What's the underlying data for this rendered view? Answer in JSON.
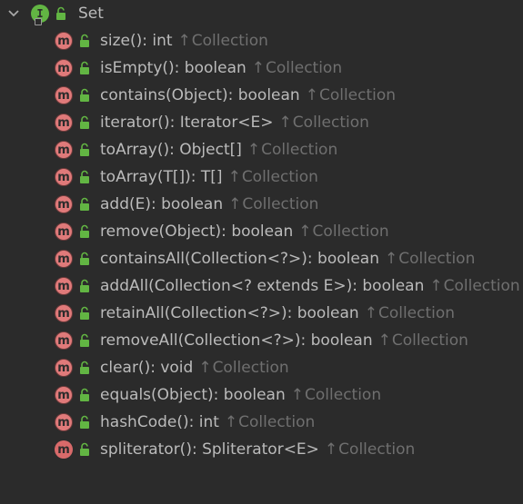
{
  "root": {
    "label": "Set",
    "icon": "interface-icon",
    "icon_letter": "I",
    "expanded": true
  },
  "colors": {
    "background": "#2b2b2b",
    "text": "#bbbbbb",
    "inherited_text": "#6f6f6f",
    "method_icon": "#e07a7a",
    "interface_icon": "#62b543",
    "lock_icon": "#62b543"
  },
  "method_icon_letter": "m",
  "arrow_glyph": "↑",
  "methods": [
    {
      "signature": "size(): int",
      "origin": "Collection"
    },
    {
      "signature": "isEmpty(): boolean",
      "origin": "Collection"
    },
    {
      "signature": "contains(Object): boolean",
      "origin": "Collection"
    },
    {
      "signature": "iterator(): Iterator<E>",
      "origin": "Collection"
    },
    {
      "signature": "toArray(): Object[]",
      "origin": "Collection"
    },
    {
      "signature": "toArray(T[]): T[]",
      "origin": "Collection"
    },
    {
      "signature": "add(E): boolean",
      "origin": "Collection"
    },
    {
      "signature": "remove(Object): boolean",
      "origin": "Collection"
    },
    {
      "signature": "containsAll(Collection<?>): boolean",
      "origin": "Collection"
    },
    {
      "signature": "addAll(Collection<? extends E>): boolean",
      "origin": "Collection"
    },
    {
      "signature": "retainAll(Collection<?>): boolean",
      "origin": "Collection"
    },
    {
      "signature": "removeAll(Collection<?>): boolean",
      "origin": "Collection"
    },
    {
      "signature": "clear(): void",
      "origin": "Collection"
    },
    {
      "signature": "equals(Object): boolean",
      "origin": "Collection"
    },
    {
      "signature": "hashCode(): int",
      "origin": "Collection"
    },
    {
      "signature": "spliterator(): Spliterator<E>",
      "origin": "Collection"
    }
  ]
}
